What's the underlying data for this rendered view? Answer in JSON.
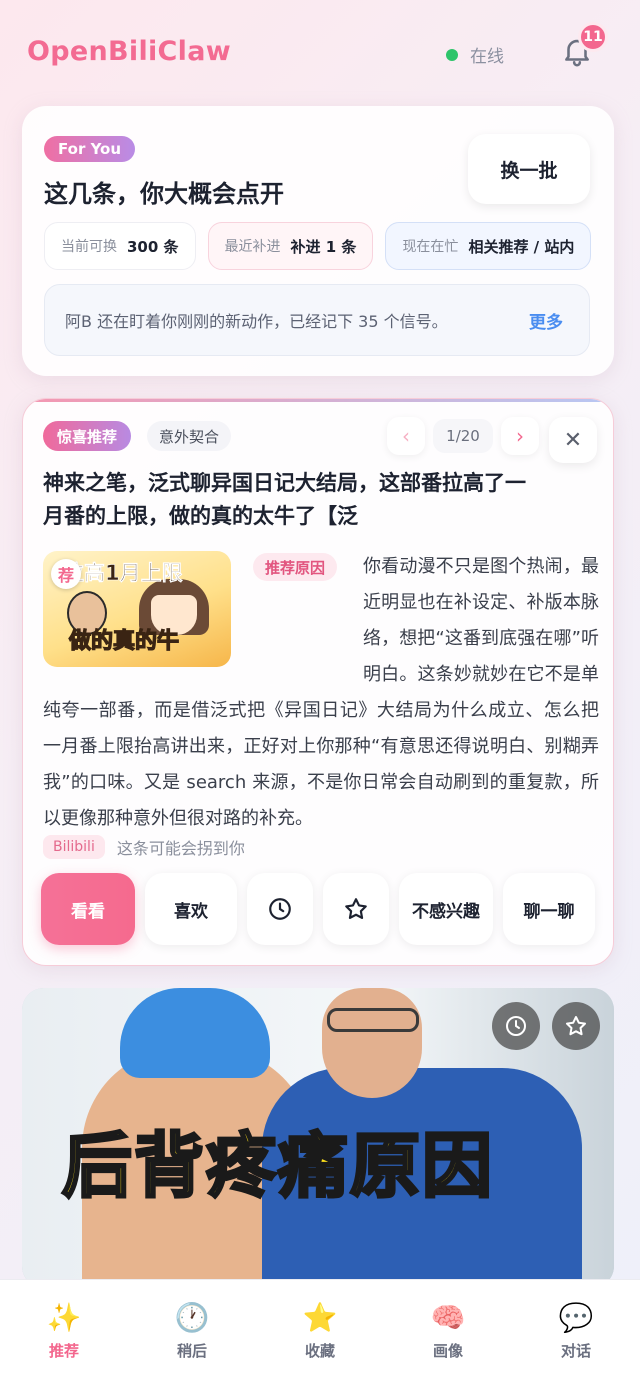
{
  "header": {
    "app_name": "OpenBiliClaw",
    "status_text": "在线",
    "notification_count": "11"
  },
  "for_you": {
    "pill": "For You",
    "title": "这几条，你大概会点开",
    "swap_button": "换一批",
    "chips": [
      {
        "label": "当前可换",
        "value": "300 条"
      },
      {
        "label": "最近补进",
        "value": "补进 1 条"
      },
      {
        "label": "现在在忙",
        "value": "相关推荐 / 站内"
      }
    ],
    "signal_text": "阿B 还在盯着你刚刚的新动作，已经记下 35 个信号。",
    "more_link": "更多"
  },
  "surprise": {
    "tag": "惊喜推荐",
    "subtag": "意外契合",
    "pager": "1/20",
    "title": "神来之笔，泛式聊异国日记大结局，这部番拉高了一月番的上限，做的真的太牛了【泛",
    "thumb_badge": "荐",
    "thumb_text_top": "拉高1月上限",
    "thumb_text_bottom": "做的真的牛",
    "reason_label": "推荐原因",
    "reason_text": "你看动漫不只是图个热闹，最近明显也在补设定、补版本脉络，想把“这番到底强在哪”听明白。这条妙就妙在它不是单纯夸一部番，而是借泛式把《异国日记》大结局为什么成立、怎么把一月番上限抬高讲出来，正好对上你那种“有意思还得说明白、别糊弄我”的口味。又是 search 来源，不是你日常会自动刷到的重复款，所以更像那种意外但很对路的补充。",
    "source": "Bilibili",
    "source_note": "这条可能会拐到你",
    "actions": {
      "watch": "看看",
      "like": "喜欢",
      "later_icon": "clock-icon",
      "favorite_icon": "star-icon",
      "dislike": "不感兴趣",
      "chat": "聊一聊"
    }
  },
  "video_card": {
    "caption": "后背疼痛原因"
  },
  "nav": [
    {
      "icon": "✨",
      "label": "推荐"
    },
    {
      "icon": "🕐",
      "label": "稍后"
    },
    {
      "icon": "⭐",
      "label": "收藏"
    },
    {
      "icon": "🧠",
      "label": "画像"
    },
    {
      "icon": "💬",
      "label": "对话"
    }
  ],
  "colors": {
    "accent": "#f3678e",
    "online": "#2ec46a",
    "link": "#4a8df0"
  }
}
